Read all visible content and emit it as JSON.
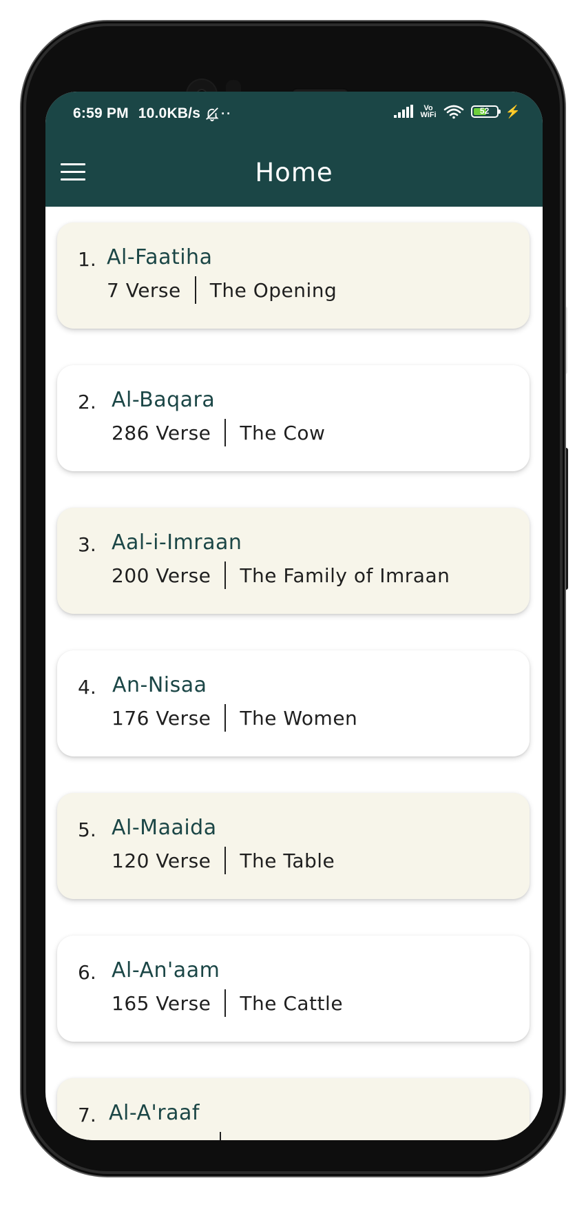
{
  "status_bar": {
    "time": "6:59 PM",
    "speed": "10.0KB/s",
    "dots": "··",
    "network_label_top": "Vo",
    "network_label_bottom": "WiFi",
    "battery_level": "52",
    "bolt": "⚡"
  },
  "app_bar": {
    "title": "Home",
    "menu_icon": "hamburger-menu-icon"
  },
  "surahs": [
    {
      "number": "1.",
      "name": "Al-Faatiha",
      "verses": "7 Verse",
      "meaning": "The Opening"
    },
    {
      "number": "2.",
      "name": "Al-Baqara",
      "verses": "286 Verse",
      "meaning": "The Cow"
    },
    {
      "number": "3.",
      "name": "Aal-i-Imraan",
      "verses": "200 Verse",
      "meaning": "The Family of Imraan"
    },
    {
      "number": "4.",
      "name": "An-Nisaa",
      "verses": "176 Verse",
      "meaning": "The Women"
    },
    {
      "number": "5.",
      "name": "Al-Maaida",
      "verses": "120 Verse",
      "meaning": "The Table"
    },
    {
      "number": "6.",
      "name": "Al-An'aam",
      "verses": "165 Verse",
      "meaning": "The Cattle"
    },
    {
      "number": "7.",
      "name": "Al-A'raaf",
      "verses": "",
      "meaning": ""
    }
  ],
  "colors": {
    "primary": "#1b4646",
    "card_alt": "#f7f5ea",
    "card_plain": "#ffffff"
  }
}
